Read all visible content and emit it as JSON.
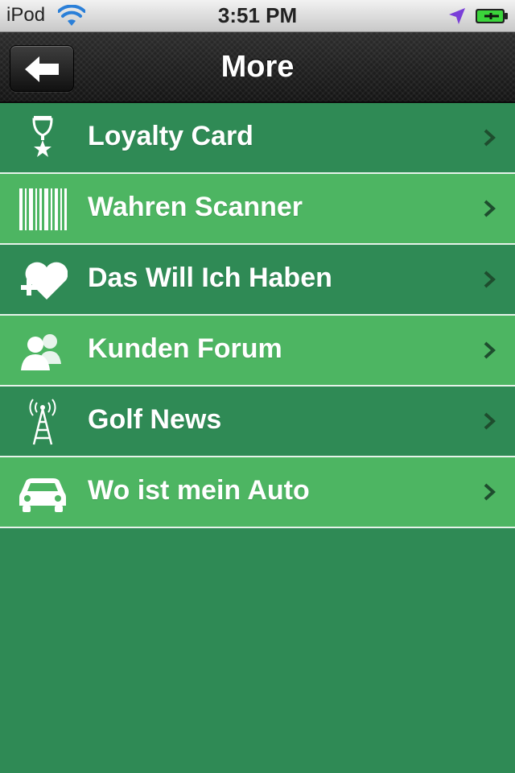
{
  "status_bar": {
    "carrier": "iPod",
    "time": "3:51 PM"
  },
  "nav": {
    "title": "More",
    "back_icon": "back-arrow-icon"
  },
  "menu": {
    "items": [
      {
        "label": "Loyalty Card",
        "icon": "trophy-star-icon"
      },
      {
        "label": "Wahren Scanner",
        "icon": "barcode-icon"
      },
      {
        "label": "Das Will Ich Haben",
        "icon": "heart-plus-icon"
      },
      {
        "label": "Kunden Forum",
        "icon": "users-icon"
      },
      {
        "label": "Golf News",
        "icon": "antenna-tower-icon"
      },
      {
        "label": "Wo ist mein Auto",
        "icon": "car-icon"
      }
    ]
  },
  "colors": {
    "row_dark": "#2f8a55",
    "row_light": "#4db562",
    "separator": "#e6f3ea",
    "chevron": "#1e4d2e"
  }
}
